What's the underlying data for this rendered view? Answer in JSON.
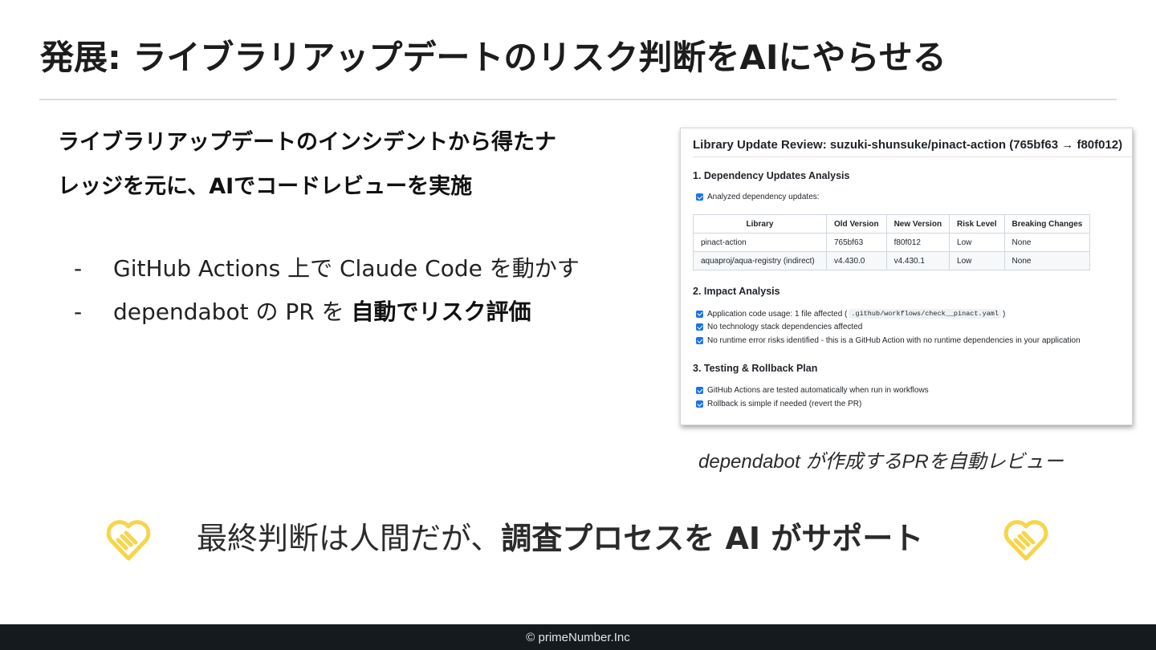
{
  "slide": {
    "title": "発展: ライブラリアップデートのリスク判断をAIにやらせる",
    "lead_line1": "ライブラリアップデートのインシデントから得たナ",
    "lead_line2": "レッジを元に、AIでコードレビューを実施",
    "bullets": [
      {
        "marker": "-",
        "text": "GitHub Actions 上で Claude Code を動かす",
        "bold": ""
      },
      {
        "marker": "-",
        "text": "dependabot の PR を ",
        "bold": "自動でリスク評価"
      }
    ],
    "caption": "dependabot が作成するPRを自動レビュー",
    "banner_text": "最終判断は人間だが、",
    "banner_bold": "調査プロセスを  AI がサポート",
    "footer": "© primeNumber.Inc",
    "colors": {
      "accent_yellow": "#f6d54a",
      "footer_bg": "#151a1e",
      "checkbox": "#1a73e8"
    },
    "icons": {
      "left": "handshake-heart-icon",
      "right": "handshake-heart-icon"
    }
  },
  "review": {
    "title": "Library Update Review: suzuki-shunsuke/pinact-action (765bf63 → f80f012)",
    "section1": "1. Dependency Updates Analysis",
    "section1_check": "Analyzed dependency updates:",
    "table": {
      "headers": [
        "Library",
        "Old Version",
        "New Version",
        "Risk Level",
        "Breaking Changes"
      ],
      "rows": [
        [
          "pinact-action",
          "765bf63",
          "f80f012",
          "Low",
          "None"
        ],
        [
          "aquaproj/aqua-registry (indirect)",
          "v4.430.0",
          "v4.430.1",
          "Low",
          "None"
        ]
      ]
    },
    "section2": "2. Impact Analysis",
    "section2_checks": {
      "c1_prefix": "Application code usage: 1 file affected (",
      "c1_code": ".github/workflows/check__pinact.yaml",
      "c1_suffix": ")",
      "c2": "No technology stack dependencies affected",
      "c3": "No runtime error risks identified - this is a GitHub Action with no runtime dependencies in your application"
    },
    "section3": "3. Testing & Rollback Plan",
    "section3_checks": [
      "GitHub Actions are tested automatically when run in workflows",
      "Rollback is simple if needed (revert the PR)"
    ]
  }
}
